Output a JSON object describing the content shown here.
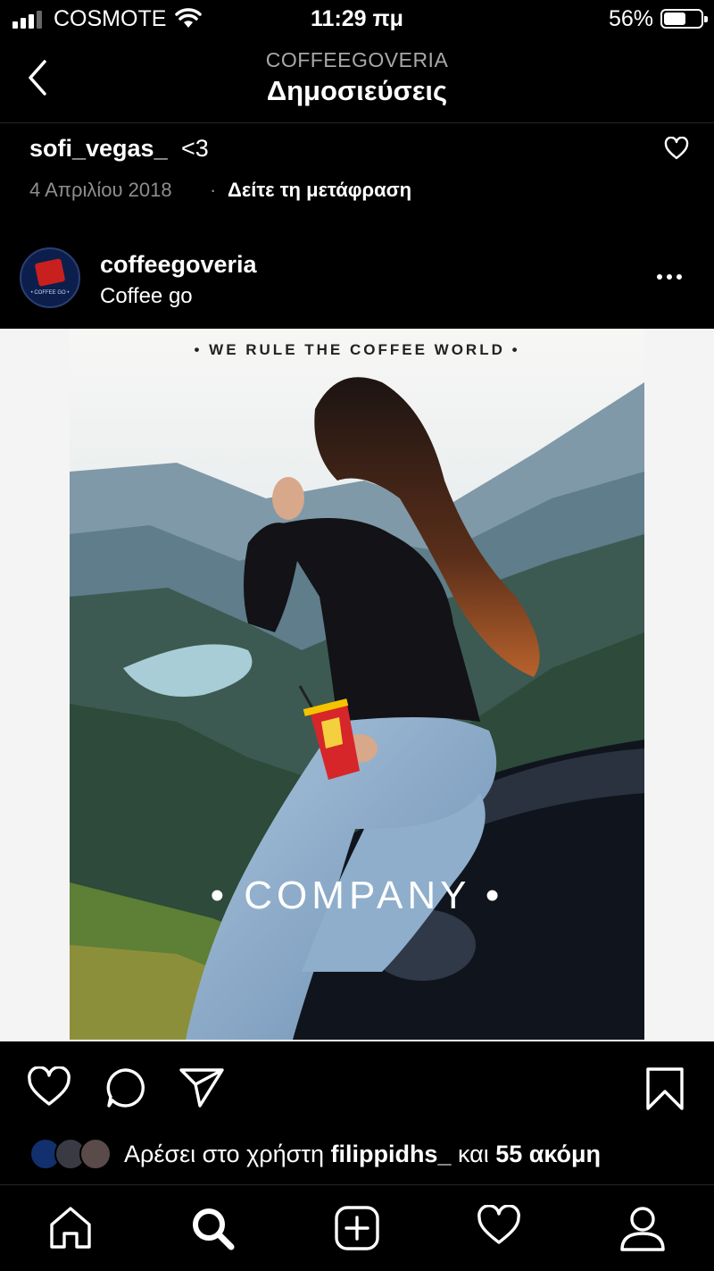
{
  "status_bar": {
    "carrier": "COSMOTE",
    "time": "11:29 πμ",
    "battery_percent": "56%",
    "battery_level": 0.56,
    "signal_bars": 3
  },
  "nav": {
    "back_icon": "chevron-left-icon",
    "subtitle": "COFFEEGOVERIA",
    "title": "Δημοσιεύσεις"
  },
  "comment": {
    "username": "sofi_vegas_",
    "text": "<3",
    "date": "4 Απριλίου 2018",
    "separator": "·",
    "translate_label": "Δείτε τη μετάφραση",
    "like_icon": "heart-outline-icon"
  },
  "post": {
    "username": "coffeegoveria",
    "location": "Coffee go",
    "more_icon": "more-dots-icon",
    "image": {
      "tagline": "• WE RULE THE COFFEE WORLD •",
      "overlay_text": "• COMPANY •"
    }
  },
  "actions": {
    "like_icon": "heart-outline-icon",
    "comment_icon": "comment-bubble-icon",
    "share_icon": "paper-plane-icon",
    "save_icon": "bookmark-icon"
  },
  "likes": {
    "prefix": "Αρέσει στο χρήστη ",
    "user": "filippidhs_",
    "middle": " και ",
    "count_text": "55 ακόμη"
  },
  "tabbar": {
    "home_icon": "home-icon",
    "search_icon": "search-icon",
    "new_post_icon": "add-post-icon",
    "activity_icon": "heart-outline-icon",
    "profile_icon": "profile-icon"
  },
  "colors": {
    "background": "#000000",
    "secondary_text": "#8e8e8e",
    "divider": "#262626",
    "image_backdrop": "#f4f4f4"
  }
}
